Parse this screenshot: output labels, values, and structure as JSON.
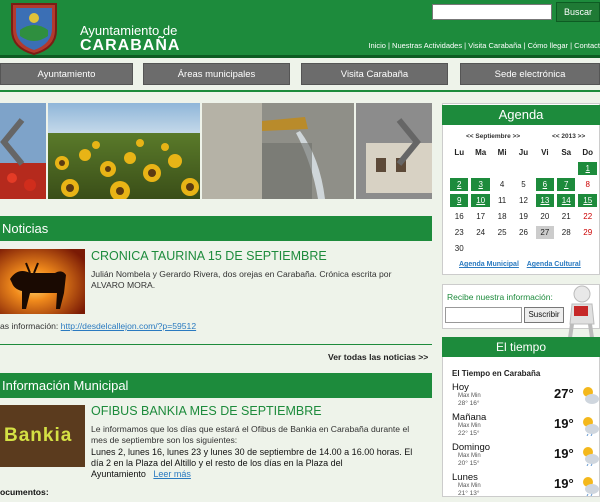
{
  "header": {
    "town_prefix": "Ayuntamiento de",
    "town_name": "CARABAÑA",
    "search_placeholder": "",
    "search_button": "Buscar",
    "links": [
      "Inicio",
      "Nuestras Actividades",
      "Visita Carabaña",
      "Cómo llegar",
      "Contact"
    ]
  },
  "nav": [
    "Ayuntamiento",
    "Áreas municipales",
    "Visita Carabaña",
    "Sede electrónica"
  ],
  "noticias": {
    "heading": "Noticias",
    "title": "CRONICA TAURINA 15 DE SEPTIEMBRE",
    "text": "Julián Nombela y Gerardo Rivera, dos orejas en Carabaña. Crónica escrita por ALVARO MORA.",
    "more_label": "as información: ",
    "more_link": "http://desdelcallejon.com/?p=59512",
    "all_news": "Ver todas las noticias >>"
  },
  "municipal": {
    "heading": "Información Municipal",
    "title": "OFIBUS BANKIA MES DE SEPTIEMBRE",
    "intro": "Le informamos que los días que estará el Ofibus de Bankia en Carabaña durante el mes de septiembre son los siguientes:",
    "days": "Lunes 2, lunes 16, lunes 23 y lunes 30 de septiembre de 14.00 a 16.00 horas. El día 2 en la Plaza del Altillo y el resto de los días en la Plaza del Ayuntamiento",
    "read_more": "Leer más",
    "documents_label": "ocumentos:",
    "logo_text": "Bankia"
  },
  "agenda": {
    "heading": "Agenda",
    "month_nav": "<< Septiembre >>",
    "year_nav": "<< 2013 >>",
    "weekdays": [
      "Lu",
      "Ma",
      "Mi",
      "Ju",
      "Vi",
      "Sa",
      "Do"
    ],
    "weeks": [
      [
        "",
        "",
        "",
        "",
        "",
        "",
        "1"
      ],
      [
        "2",
        "3",
        "4",
        "5",
        "6",
        "7",
        "8"
      ],
      [
        "9",
        "10",
        "11",
        "12",
        "13",
        "14",
        "15"
      ],
      [
        "16",
        "17",
        "18",
        "19",
        "20",
        "21",
        "22"
      ],
      [
        "23",
        "24",
        "25",
        "26",
        "27",
        "28",
        "29"
      ],
      [
        "30",
        "",
        "",
        "",
        "",
        "",
        ""
      ]
    ],
    "event_days": [
      "1",
      "2",
      "3",
      "6",
      "7",
      "9",
      "10",
      "13",
      "14",
      "15"
    ],
    "today": "27",
    "link_municipal": "Agenda Municipal",
    "link_cultural": "Agenda Cultural"
  },
  "subscribe": {
    "label": "Recibe nuestra información:",
    "button": "Suscribir"
  },
  "weather": {
    "heading": "El tiempo",
    "subtitle": "El Tiempo en Carabaña",
    "max_label": "Max Min",
    "days": [
      {
        "day": "Hoy",
        "maxmin": "28° 16°",
        "temp": "27°"
      },
      {
        "day": "Mañana",
        "maxmin": "22° 15°",
        "temp": "19°"
      },
      {
        "day": "Domingo",
        "maxmin": "20° 15°",
        "temp": "19°"
      },
      {
        "day": "Lunes",
        "maxmin": "21° 13°",
        "temp": "19°"
      }
    ]
  },
  "colors": {
    "brand_green": "#1d8b3c",
    "nav_gray": "#6c6c6c",
    "link_blue": "#2a7ac0"
  }
}
